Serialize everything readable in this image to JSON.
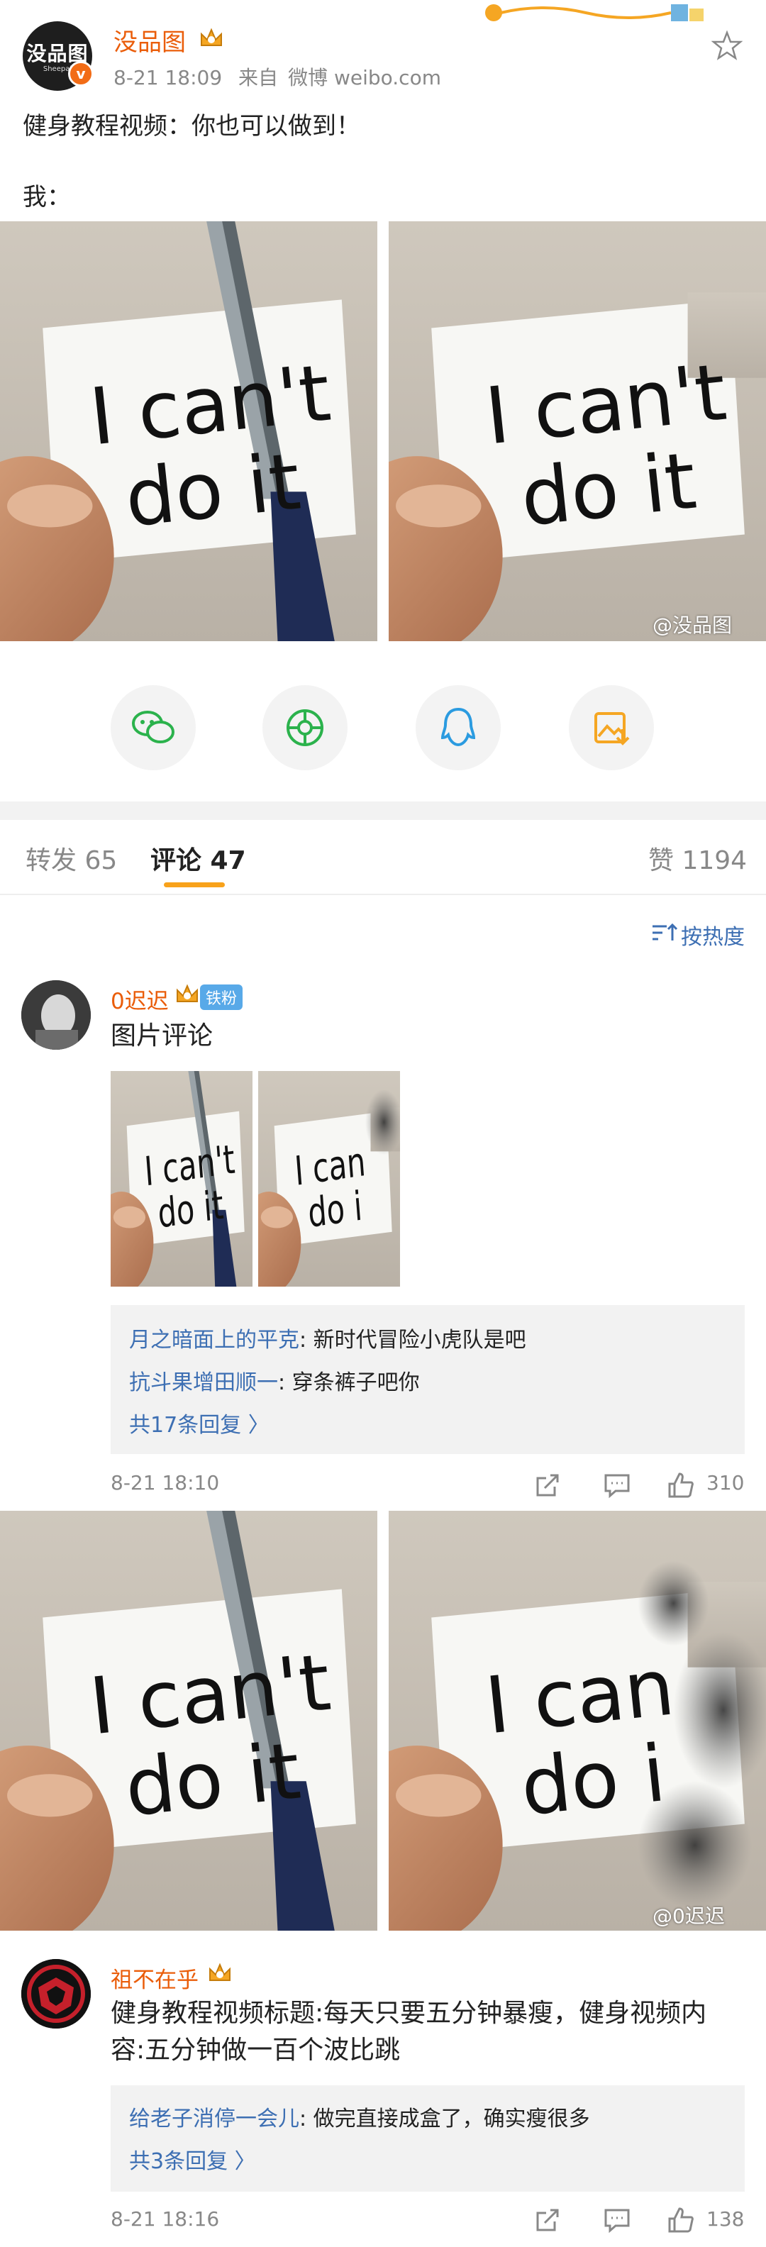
{
  "post": {
    "author": "没品图",
    "avatar_text": "没品图",
    "avatar_sub": "Sheepai",
    "timestamp": "8-21 18:09",
    "source_prefix": "来自",
    "source": "微博 weibo.com",
    "text_line1": "健身教程视频：你也可以做到！",
    "text_line2": "我：",
    "watermark": "@没品图"
  },
  "share": {
    "items": [
      "wechat-icon",
      "moments-icon",
      "qq-icon",
      "save-image-icon"
    ]
  },
  "tabs": {
    "repost_label": "转发 65",
    "comment_label": "评论 47",
    "like_label": "赞 1194"
  },
  "sort": {
    "label": "按热度"
  },
  "comments": [
    {
      "user": "0迟迟",
      "badge": "铁粉",
      "text": "图片评论",
      "replies": [
        {
          "user": "月之暗面上的平克",
          "text": ": 新时代冒险小虎队是吧"
        },
        {
          "user": "抗斗果增田顺一",
          "text": ": 穿条裤子吧你"
        }
      ],
      "more": "共17条回复 〉",
      "time": "8-21 18:10",
      "likes": "310",
      "watermark": "@0迟迟"
    },
    {
      "user": "祖不在乎",
      "text_line1": "健身教程视频标题:每天只要五分钟暴瘦，健身视频内",
      "text_line2": "容:五分钟做一百个波比跳",
      "replies": [
        {
          "user": "给老子消停一会儿",
          "text": ": 做完直接成盒了，确实瘦很多"
        }
      ],
      "more": "共3条回复 〉",
      "time": "8-21 18:16",
      "likes": "138"
    }
  ],
  "photo": {
    "left_line1": "I can't",
    "left_line2": "do it",
    "right_line1": "I can't",
    "right_line2": "do it",
    "right_cut_line1": "I can",
    "right_cut_line2": "do i"
  },
  "colors": {
    "brand_orange": "#ea5d0a",
    "link_blue": "#3d6fb3",
    "tab_accent": "#f8a21b"
  }
}
